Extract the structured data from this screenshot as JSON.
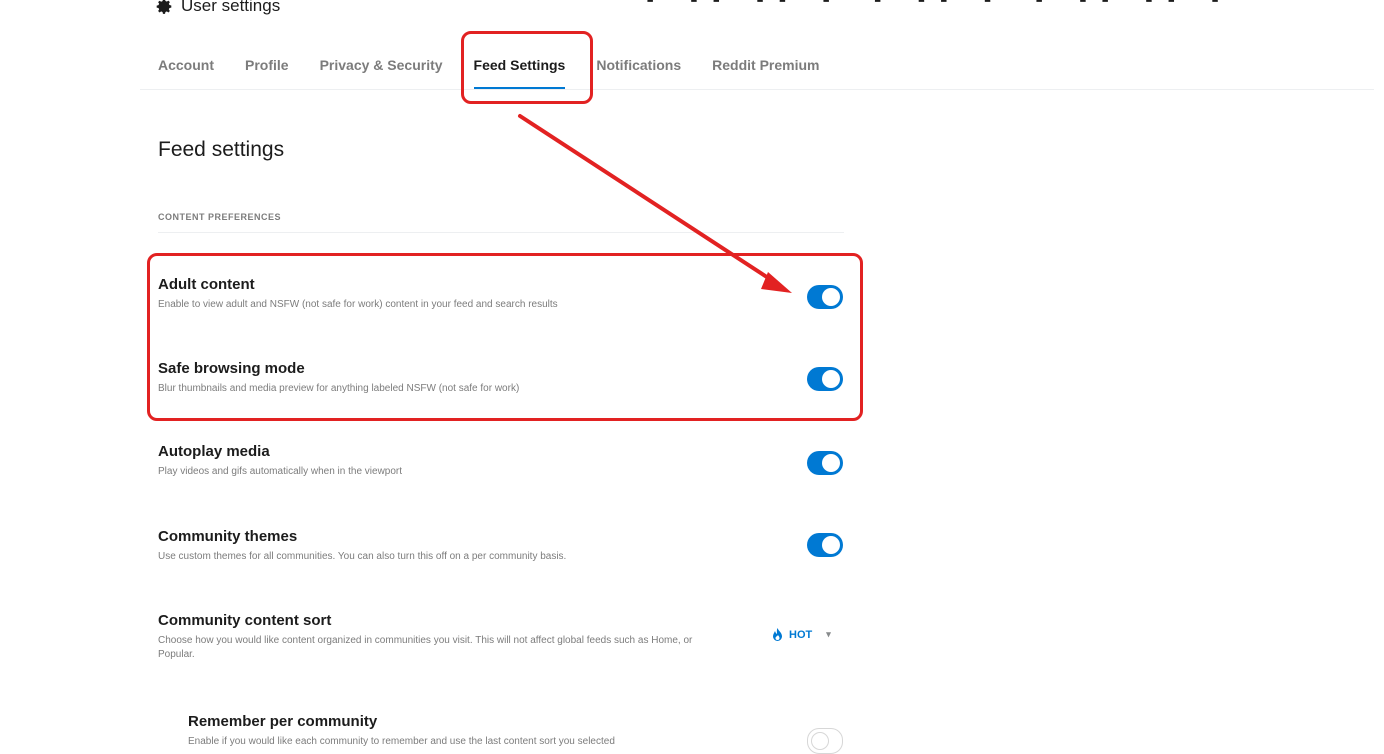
{
  "header": {
    "title": "User settings",
    "gear_icon": "gear-icon",
    "decorative_text": "◠◠◠ ◠◠ ◠◠◠"
  },
  "tabs": [
    {
      "label": "Account"
    },
    {
      "label": "Profile"
    },
    {
      "label": "Privacy & Security"
    },
    {
      "label": "Feed Settings",
      "active": true
    },
    {
      "label": "Notifications"
    },
    {
      "label": "Reddit Premium"
    }
  ],
  "page": {
    "title": "Feed settings",
    "section_label": "CONTENT PREFERENCES"
  },
  "settings": [
    {
      "title": "Adult content",
      "desc": "Enable to view adult and NSFW (not safe for work) content in your feed and search results",
      "on": true
    },
    {
      "title": "Safe browsing mode",
      "desc": "Blur thumbnails and media preview for anything labeled NSFW (not safe for work)",
      "on": true
    },
    {
      "title": "Autoplay media",
      "desc": "Play videos and gifs automatically when in the viewport",
      "on": true
    },
    {
      "title": "Community themes",
      "desc": "Use custom themes for all communities. You can also turn this off on a per community basis.",
      "on": true
    },
    {
      "title": "Community content sort",
      "desc": "Choose how you would like content organized in communities you visit. This will not affect global feeds such as Home, or Popular."
    }
  ],
  "sort": {
    "value": "HOT",
    "icon": "flame-icon",
    "caret_icon": "caret-down-icon"
  },
  "sub_setting": {
    "title": "Remember per community",
    "desc": "Enable if you would like each community to remember and use the last content sort you selected",
    "on": false
  },
  "colors": {
    "accent": "#0079d3",
    "highlight": "#e22222"
  }
}
